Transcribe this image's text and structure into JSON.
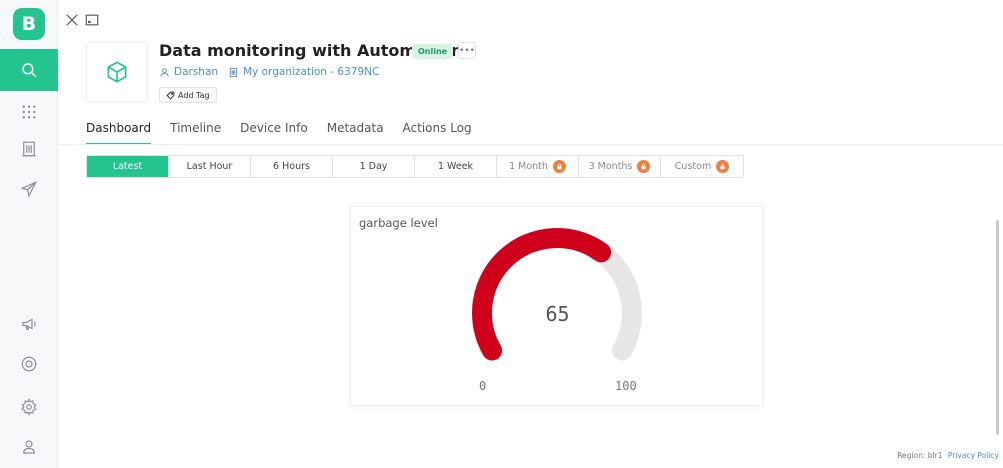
{
  "app": {
    "logo_letter": "B"
  },
  "sidebar": {
    "items": [
      {
        "name": "search",
        "icon": "search-icon",
        "active": true
      },
      {
        "name": "devices",
        "icon": "grid-icon",
        "active": false
      },
      {
        "name": "organizations",
        "icon": "building-icon",
        "active": false
      },
      {
        "name": "send",
        "icon": "send-icon",
        "active": false
      },
      {
        "name": "announcements",
        "icon": "megaphone-icon",
        "active": false
      },
      {
        "name": "help",
        "icon": "lifebuoy-icon",
        "active": false
      },
      {
        "name": "settings",
        "icon": "gear-icon",
        "active": false
      },
      {
        "name": "profile",
        "icon": "user-icon",
        "active": false
      }
    ]
  },
  "device": {
    "title": "Data monitoring with Automation",
    "status": "Online",
    "more": "•••",
    "owner": "Darshan",
    "organization": "My organization - 6379NC",
    "add_tag": "Add Tag"
  },
  "tabs": [
    "Dashboard",
    "Timeline",
    "Device Info",
    "Metadata",
    "Actions Log"
  ],
  "active_tab": "Dashboard",
  "time_range": {
    "options": [
      {
        "label": "Latest",
        "active": true,
        "locked": false
      },
      {
        "label": "Last Hour",
        "active": false,
        "locked": false
      },
      {
        "label": "6 Hours",
        "active": false,
        "locked": false
      },
      {
        "label": "1 Day",
        "active": false,
        "locked": false
      },
      {
        "label": "1 Week",
        "active": false,
        "locked": false
      },
      {
        "label": "1 Month",
        "active": false,
        "locked": true
      },
      {
        "label": "3 Months",
        "active": false,
        "locked": true
      },
      {
        "label": "Custom",
        "active": false,
        "locked": true
      }
    ]
  },
  "widget": {
    "title": "garbage level",
    "value": "65",
    "min": "0",
    "max": "100",
    "fraction": 0.65,
    "fill_color": "#d0021b",
    "track_color": "#e6e6e6"
  },
  "footer": {
    "region": "Region: blr1",
    "privacy": "Privacy Policy"
  },
  "colors": {
    "accent": "#23c48e",
    "lock": "#f07e3c",
    "link": "#4a90c8"
  }
}
